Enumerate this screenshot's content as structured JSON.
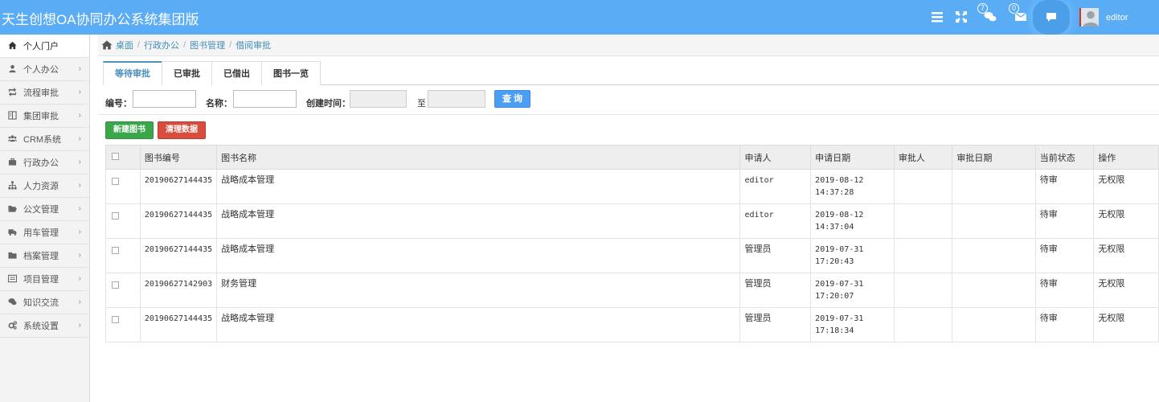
{
  "header": {
    "title": "天生创想OA协同办公系统集团版",
    "icons": [
      "menu-icon",
      "fullscreen-icon",
      "chat-bubbles-icon",
      "mail-icon",
      "comment-icon"
    ],
    "badges": {
      "messages": "7",
      "mail": "0"
    },
    "username": "editor",
    "colors": {
      "bar": "#5aacf5"
    }
  },
  "sidebar": {
    "items": [
      {
        "label": "个人门户",
        "icon": "home-icon",
        "active": true
      },
      {
        "label": "个人办公",
        "icon": "user-icon"
      },
      {
        "label": "流程审批",
        "icon": "retweet-icon"
      },
      {
        "label": "集团审批",
        "icon": "columns-icon"
      },
      {
        "label": "CRM系统",
        "icon": "group-icon"
      },
      {
        "label": "行政办公",
        "icon": "briefcase-icon"
      },
      {
        "label": "人力资源",
        "icon": "sitemap-icon"
      },
      {
        "label": "公文管理",
        "icon": "folder-open-icon"
      },
      {
        "label": "用车管理",
        "icon": "truck-icon"
      },
      {
        "label": "档案管理",
        "icon": "folder-icon"
      },
      {
        "label": "项目管理",
        "icon": "list-alt-icon"
      },
      {
        "label": "知识交流",
        "icon": "comments-icon"
      },
      {
        "label": "系统设置",
        "icon": "cogs-icon"
      }
    ]
  },
  "breadcrumb": [
    "桌面",
    "行政办公",
    "图书管理",
    "借阅审批"
  ],
  "tabs": [
    {
      "label": "等待审批",
      "active": true
    },
    {
      "label": "已审批"
    },
    {
      "label": "已借出"
    },
    {
      "label": "图书一览"
    }
  ],
  "search": {
    "number_label": "编号：",
    "name_label": "名称：",
    "created_label": "创建时间：",
    "to_label": "至",
    "query_button": "查 询",
    "number_value": "",
    "name_value": "",
    "date_from": "",
    "date_to": ""
  },
  "actions": {
    "new_book": "新建图书",
    "clear_data": "清理数据"
  },
  "table": {
    "columns": [
      "图书编号",
      "图书名称",
      "申请人",
      "申请日期",
      "审批人",
      "审批日期",
      "当前状态",
      "操作"
    ],
    "rows": [
      {
        "code": "20190627144435",
        "name": "战略成本管理",
        "applicant": "editor",
        "date1": "2019-08-12",
        "date2": "14:37:28",
        "approver": "",
        "approve_date": "",
        "status": "待审",
        "op": "无权限"
      },
      {
        "code": "20190627144435",
        "name": "战略成本管理",
        "applicant": "editor",
        "date1": "2019-08-12",
        "date2": "14:37:04",
        "approver": "",
        "approve_date": "",
        "status": "待审",
        "op": "无权限"
      },
      {
        "code": "20190627144435",
        "name": "战略成本管理",
        "applicant": "管理员",
        "date1": "2019-07-31",
        "date2": "17:20:43",
        "approver": "",
        "approve_date": "",
        "status": "待审",
        "op": "无权限"
      },
      {
        "code": "20190627142903",
        "name": "财务管理",
        "applicant": "管理员",
        "date1": "2019-07-31",
        "date2": "17:20:07",
        "approver": "",
        "approve_date": "",
        "status": "待审",
        "op": "无权限"
      },
      {
        "code": "20190627144435",
        "name": "战略成本管理",
        "applicant": "管理员",
        "date1": "2019-07-31",
        "date2": "17:18:34",
        "approver": "",
        "approve_date": "",
        "status": "待审",
        "op": "无权限"
      }
    ]
  }
}
